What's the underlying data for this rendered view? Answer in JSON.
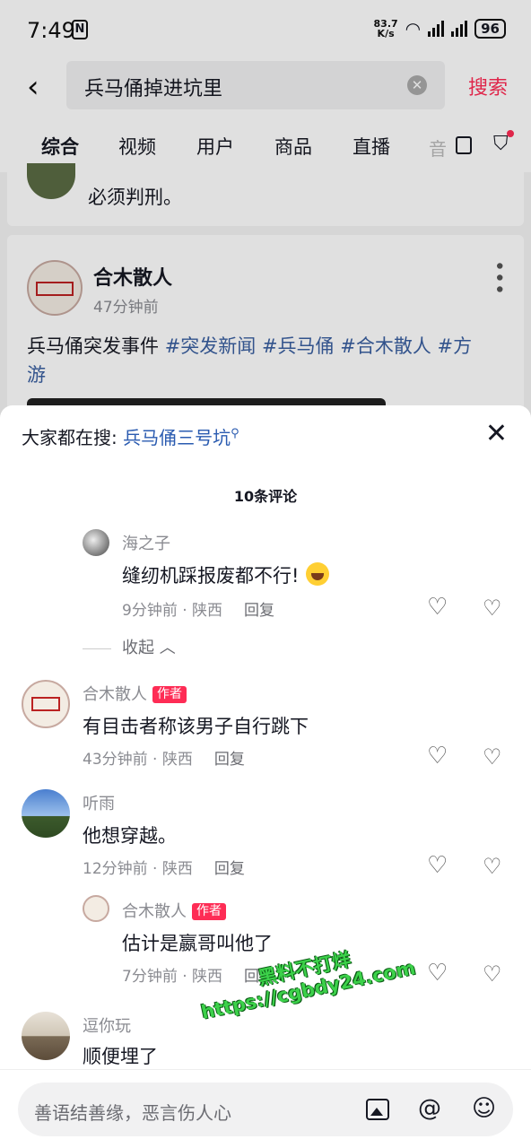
{
  "status": {
    "time": "7:49",
    "speed_top": "83.7",
    "speed_bottom": "K/s",
    "battery": "96"
  },
  "search": {
    "query": "兵马俑掉进坑里",
    "button": "搜索"
  },
  "tabs": [
    "综合",
    "视频",
    "用户",
    "商品",
    "直播",
    "音"
  ],
  "feed": {
    "card1_text": "必须判刑。",
    "card2": {
      "author": "合木散人",
      "logo_text": "合木散人",
      "time": "47分钟前",
      "text_plain": "兵马俑突发事件 ",
      "tags": "#突发新闻 #兵马俑 #合木散人 #方",
      "text_line2": "游"
    }
  },
  "sheet": {
    "hot_prefix": "大家都在搜:",
    "hot_link": "兵马俑三号坑",
    "count": "10条评论",
    "collapse": "收起",
    "reply_label": "回复",
    "author_tag": "作者",
    "comments": [
      {
        "user": "海之子",
        "text": "缝纫机踩报废都不行!",
        "time": "9分钟前",
        "loc": "陕西"
      },
      {
        "user": "合木散人",
        "text": "有目击者称该男子自行跳下",
        "time": "43分钟前",
        "loc": "陕西"
      },
      {
        "user": "听雨",
        "text": "他想穿越。",
        "time": "12分钟前",
        "loc": "陕西"
      },
      {
        "user": "合木散人",
        "text": "估计是嬴哥叫他了",
        "time": "7分钟前",
        "loc": "陕西"
      },
      {
        "user": "逗你玩",
        "text": "顺便埋了"
      }
    ],
    "input_placeholder": "善语结善缘，恶言伤人心"
  },
  "watermark": {
    "line1": "黑料不打烊",
    "line2": "https://cgbdy24.com"
  }
}
